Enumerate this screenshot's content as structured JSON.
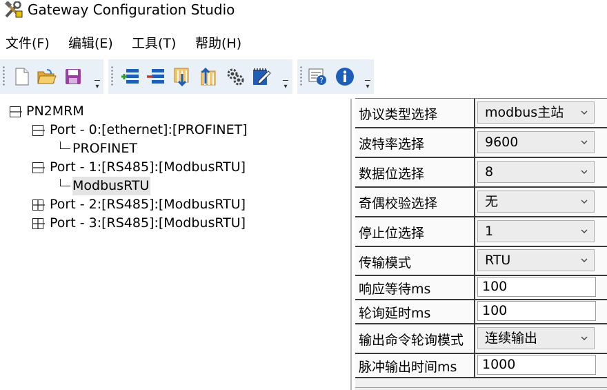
{
  "window": {
    "title": "Gateway Configuration Studio"
  },
  "menu": {
    "file": "文件(F)",
    "edit": "编辑(E)",
    "tools": "工具(T)",
    "help": "帮助(H)"
  },
  "toolbar": {
    "groups": [
      {
        "buttons": [
          "new-file-icon",
          "open-folder-icon",
          "save-disk-icon"
        ]
      },
      {
        "buttons": [
          "add-device-icon",
          "remove-device-icon",
          "download-config-icon",
          "upload-config-icon",
          "settings-gear-icon",
          "edit-note-icon"
        ]
      },
      {
        "buttons": [
          "help-context-icon",
          "info-icon"
        ]
      }
    ],
    "colors": {
      "background": "#eaf0f8",
      "accent_blue": "#1d5fb8",
      "accent_orange": "#e08a1e",
      "accent_red": "#c0392b",
      "accent_purple": "#9b3fa7"
    }
  },
  "tree": {
    "root": "PN2MRM",
    "ports": [
      {
        "label": "Port - 0:[ethernet]:[PROFINET]",
        "expanded": true,
        "child": "PROFINET"
      },
      {
        "label": "Port - 1:[RS485]:[ModbusRTU]",
        "expanded": true,
        "child": "ModbusRTU"
      },
      {
        "label": "Port - 2:[RS485]:[ModbusRTU]",
        "expanded": false
      },
      {
        "label": "Port - 3:[RS485]:[ModbusRTU]",
        "expanded": false
      }
    ],
    "selected": "ModbusRTU"
  },
  "properties": {
    "rows": [
      {
        "label": "协议类型选择",
        "value": "modbus主站",
        "type": "select"
      },
      {
        "label": "波特率选择",
        "value": "9600",
        "type": "select"
      },
      {
        "label": "数据位选择",
        "value": "8",
        "type": "select"
      },
      {
        "label": "奇偶校验选择",
        "value": "无",
        "type": "select"
      },
      {
        "label": "停止位选择",
        "value": "1",
        "type": "select"
      },
      {
        "label": "传输模式",
        "value": "RTU",
        "type": "select"
      },
      {
        "label": "响应等待ms",
        "value": "100",
        "type": "text"
      },
      {
        "label": "轮询延时ms",
        "value": "100",
        "type": "text"
      },
      {
        "label": "输出命令轮询模式",
        "value": "连续输出",
        "type": "select"
      },
      {
        "label": "脉冲输出时间ms",
        "value": "1000",
        "type": "text"
      }
    ]
  }
}
